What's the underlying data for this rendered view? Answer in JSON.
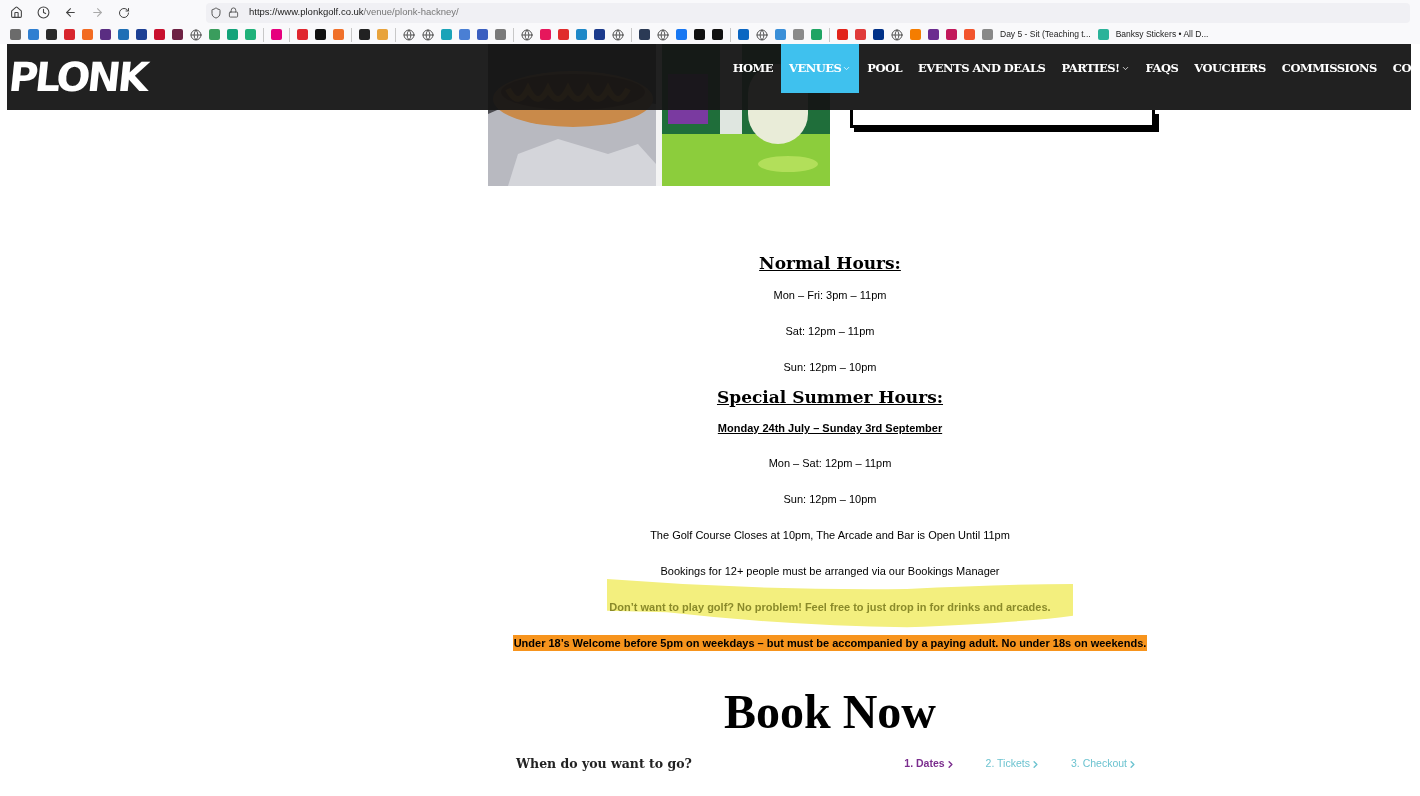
{
  "browser": {
    "url_host": "https://www.plonkgolf.co.uk",
    "url_path": "/venue/plonk-hackney/",
    "bookmarks": [
      {
        "kind": "icon",
        "color": "#6b6b6b"
      },
      {
        "kind": "icon",
        "color": "#2f7fd1"
      },
      {
        "kind": "icon",
        "color": "#2b2b2b"
      },
      {
        "kind": "icon",
        "color": "#d8262e"
      },
      {
        "kind": "icon",
        "color": "#f26b21"
      },
      {
        "kind": "icon",
        "color": "#5a2d82"
      },
      {
        "kind": "icon",
        "color": "#1f6fb5"
      },
      {
        "kind": "icon",
        "color": "#1c3f94"
      },
      {
        "kind": "icon",
        "color": "#c8102e"
      },
      {
        "kind": "icon",
        "color": "#6d2143"
      },
      {
        "kind": "globe"
      },
      {
        "kind": "icon",
        "color": "#3a9d5d"
      },
      {
        "kind": "icon",
        "color": "#12a37a"
      },
      {
        "kind": "icon",
        "color": "#20b27a"
      },
      {
        "kind": "separator"
      },
      {
        "kind": "icon",
        "color": "#e6007e"
      },
      {
        "kind": "separator"
      },
      {
        "kind": "icon",
        "color": "#e0262f"
      },
      {
        "kind": "icon",
        "color": "#111111"
      },
      {
        "kind": "icon",
        "color": "#f0702a"
      },
      {
        "kind": "separator"
      },
      {
        "kind": "icon",
        "color": "#222222"
      },
      {
        "kind": "icon",
        "color": "#e8a33c"
      },
      {
        "kind": "separator"
      },
      {
        "kind": "globe"
      },
      {
        "kind": "globe"
      },
      {
        "kind": "icon",
        "color": "#1aa3b8"
      },
      {
        "kind": "icon",
        "color": "#4a7fd4"
      },
      {
        "kind": "icon",
        "color": "#3b5fc0"
      },
      {
        "kind": "icon",
        "color": "#7a7a7a"
      },
      {
        "kind": "separator"
      },
      {
        "kind": "globe"
      },
      {
        "kind": "icon",
        "color": "#e6175c"
      },
      {
        "kind": "icon",
        "color": "#e02c2c"
      },
      {
        "kind": "icon",
        "color": "#1e88c8"
      },
      {
        "kind": "icon",
        "color": "#1b3a8c"
      },
      {
        "kind": "globe"
      },
      {
        "kind": "separator"
      },
      {
        "kind": "icon",
        "color": "#2b3a55"
      },
      {
        "kind": "globe"
      },
      {
        "kind": "icon",
        "color": "#1877f2"
      },
      {
        "kind": "icon",
        "color": "#111111"
      },
      {
        "kind": "icon",
        "color": "#111111"
      },
      {
        "kind": "separator"
      },
      {
        "kind": "icon",
        "color": "#0a66c2"
      },
      {
        "kind": "globe"
      },
      {
        "kind": "icon",
        "color": "#3a8fd8"
      },
      {
        "kind": "icon",
        "color": "#8a8a8a"
      },
      {
        "kind": "icon",
        "color": "#1fa463"
      },
      {
        "kind": "separator"
      },
      {
        "kind": "icon",
        "color": "#e2231a"
      },
      {
        "kind": "icon",
        "color": "#e03a3a"
      },
      {
        "kind": "icon",
        "color": "#003087"
      },
      {
        "kind": "globe"
      },
      {
        "kind": "icon",
        "color": "#f57d00"
      },
      {
        "kind": "icon",
        "color": "#6b2c8f"
      },
      {
        "kind": "icon",
        "color": "#c2185b"
      },
      {
        "kind": "icon",
        "color": "#f2542d"
      },
      {
        "kind": "icon",
        "color": "#888888"
      },
      {
        "kind": "labeled",
        "label": "Day 5 - Sit (Teaching t..."
      },
      {
        "kind": "icon",
        "color": "#2bb39a"
      },
      {
        "kind": "labeled",
        "label": "Banksy Stickers • All D..."
      }
    ]
  },
  "header": {
    "logo": "PLONK",
    "nav": [
      {
        "label": "HOME",
        "selected": false,
        "dropdown": false
      },
      {
        "label": "VENUES",
        "selected": true,
        "dropdown": true
      },
      {
        "label": "POOL",
        "selected": false,
        "dropdown": false
      },
      {
        "label": "EVENTS AND DEALS",
        "selected": false,
        "dropdown": false
      },
      {
        "label": "PARTIES!",
        "selected": false,
        "dropdown": true
      },
      {
        "label": "FAQS",
        "selected": false,
        "dropdown": false
      },
      {
        "label": "VOUCHERS",
        "selected": false,
        "dropdown": false
      },
      {
        "label": "COMMISSIONS",
        "selected": false,
        "dropdown": false
      },
      {
        "label": "CO",
        "selected": false,
        "dropdown": false
      }
    ]
  },
  "hours": [
    {
      "kind": "heading",
      "text": "Normal Hours:"
    },
    {
      "kind": "line",
      "text": "Mon – Fri: 3pm – 11pm"
    },
    {
      "kind": "line",
      "text": "Sat: 12pm – 11pm"
    },
    {
      "kind": "line",
      "text": "Sun: 12pm – 10pm"
    },
    {
      "kind": "heading",
      "text": "Special Summer Hours:"
    },
    {
      "kind": "subheading",
      "text": "Monday 24th July – Sunday 3rd September"
    },
    {
      "kind": "line",
      "text": "Mon – Sat: 12pm – 11pm"
    },
    {
      "kind": "line",
      "text": "Sun: 12pm – 10pm"
    },
    {
      "kind": "line",
      "text": "The Golf Course Closes at 10pm, The Arcade and Bar is Open Until 11pm"
    },
    {
      "kind": "line",
      "text": "Bookings for 12+ people must be arranged via our Bookings Manager"
    },
    {
      "kind": "highlighted",
      "text": "Don’t want to play golf? No problem! Feel free to just drop in for drinks and arcades."
    },
    {
      "kind": "notice",
      "text": "Under 18’s Welcome before 5pm on weekdays – but must be accompanied by a paying adult. No under 18s on weekends."
    }
  ],
  "booking": {
    "title": "Book Now",
    "question": "When do you want to go?",
    "steps": [
      {
        "label": "1. Dates",
        "selected": true
      },
      {
        "label": "2. Tickets",
        "selected": false
      },
      {
        "label": "3. Checkout",
        "selected": false
      }
    ]
  }
}
